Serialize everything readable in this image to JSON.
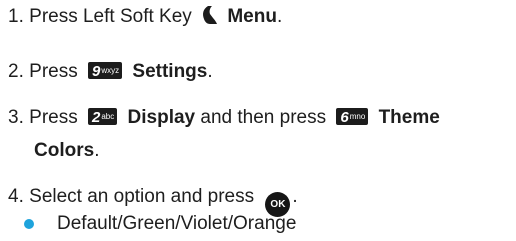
{
  "accent_color": "#1ea3dc",
  "steps": [
    {
      "number": "1.",
      "text_before": "Press Left Soft Key",
      "icon": "left-soft-key-icon",
      "bold": "Menu",
      "text_after": "."
    },
    {
      "number": "2.",
      "text_before": "Press",
      "key": {
        "digit": "9",
        "letters": "wxyz"
      },
      "bold": "Settings",
      "text_after": "."
    },
    {
      "number": "3.",
      "text_before": "Press",
      "key": {
        "digit": "2",
        "letters": "abc"
      },
      "bold": "Display",
      "middle": "and then press",
      "key2": {
        "digit": "6",
        "letters": "mno"
      },
      "bold2_line1": "Theme",
      "bold2_line2": "Colors",
      "text_after": "."
    },
    {
      "number": "4.",
      "text_before": "Select an option and press",
      "ok_label": "OK",
      "text_after": "."
    }
  ],
  "options": [
    "Default/Green/Violet/Orange"
  ]
}
